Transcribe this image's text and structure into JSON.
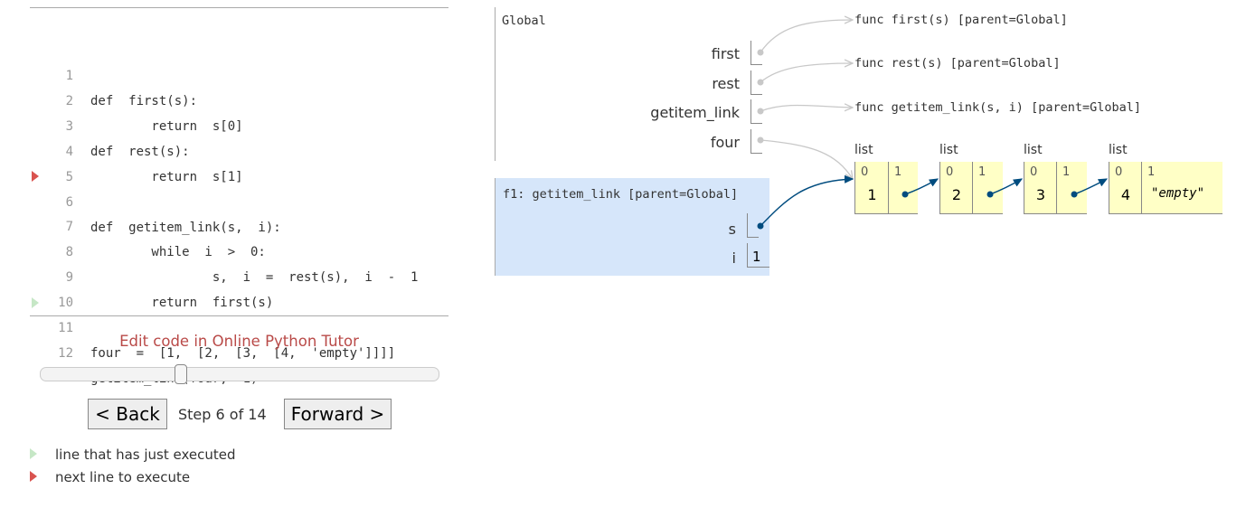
{
  "code": {
    "lines": [
      {
        "no": "1",
        "text": "def  first(s):",
        "marker": ""
      },
      {
        "no": "2",
        "text": "        return  s[0]",
        "marker": ""
      },
      {
        "no": "3",
        "text": "def  rest(s):",
        "marker": ""
      },
      {
        "no": "4",
        "text": "        return  s[1]",
        "marker": ""
      },
      {
        "no": "5",
        "text": "",
        "marker": ""
      },
      {
        "no": "6",
        "text": "def  getitem_link(s,  i):",
        "marker": ""
      },
      {
        "no": "7",
        "text": "        while  i  >  0:",
        "marker": "next"
      },
      {
        "no": "8",
        "text": "                s,  i  =  rest(s),  i  -  1",
        "marker": ""
      },
      {
        "no": "9",
        "text": "        return  first(s)",
        "marker": ""
      },
      {
        "no": "10",
        "text": "",
        "marker": ""
      },
      {
        "no": "11",
        "text": "four  =  [1,  [2,  [3,  [4,  'empty']]]]",
        "marker": ""
      },
      {
        "no": "12",
        "text": "getitem_link(four,  1)",
        "marker": "prev"
      }
    ]
  },
  "edit_link": "Edit code in Online Python Tutor",
  "navigation": {
    "back_label": "< Back",
    "forward_label": "Forward >",
    "step_text": "Step 6 of 14",
    "current_step": 6,
    "total_steps": 14
  },
  "legend": {
    "prev_label": "line that has just executed",
    "next_label": "next line to execute"
  },
  "global_frame": {
    "title": "Global",
    "vars": [
      "first",
      "rest",
      "getitem_link",
      "four"
    ]
  },
  "functions": [
    "func first(s) [parent=Global]",
    "func rest(s) [parent=Global]",
    "func getitem_link(s,  i) [parent=Global]"
  ],
  "f1_frame": {
    "title": "f1: getitem_link [parent=Global]",
    "vars": [
      {
        "name": "s",
        "value": ""
      },
      {
        "name": "i",
        "value": "1"
      }
    ]
  },
  "lists": [
    {
      "label": "list",
      "idx0": "0",
      "idx1": "1",
      "v0": "1"
    },
    {
      "label": "list",
      "idx0": "0",
      "idx1": "1",
      "v0": "2"
    },
    {
      "label": "list",
      "idx0": "0",
      "idx1": "1",
      "v0": "3"
    },
    {
      "label": "list",
      "idx0": "0",
      "idx1": "1",
      "v0": "4",
      "v1": "\"empty\""
    }
  ],
  "colors": {
    "next_marker": "#d9534f",
    "prev_marker": "#c6e7c6",
    "frame_highlight": "#d6e6fa",
    "heap_object": "#ffffc6",
    "pointer_active": "#004c7f",
    "pointer_inactive": "#c8c8c8",
    "link": "#b94a48"
  }
}
